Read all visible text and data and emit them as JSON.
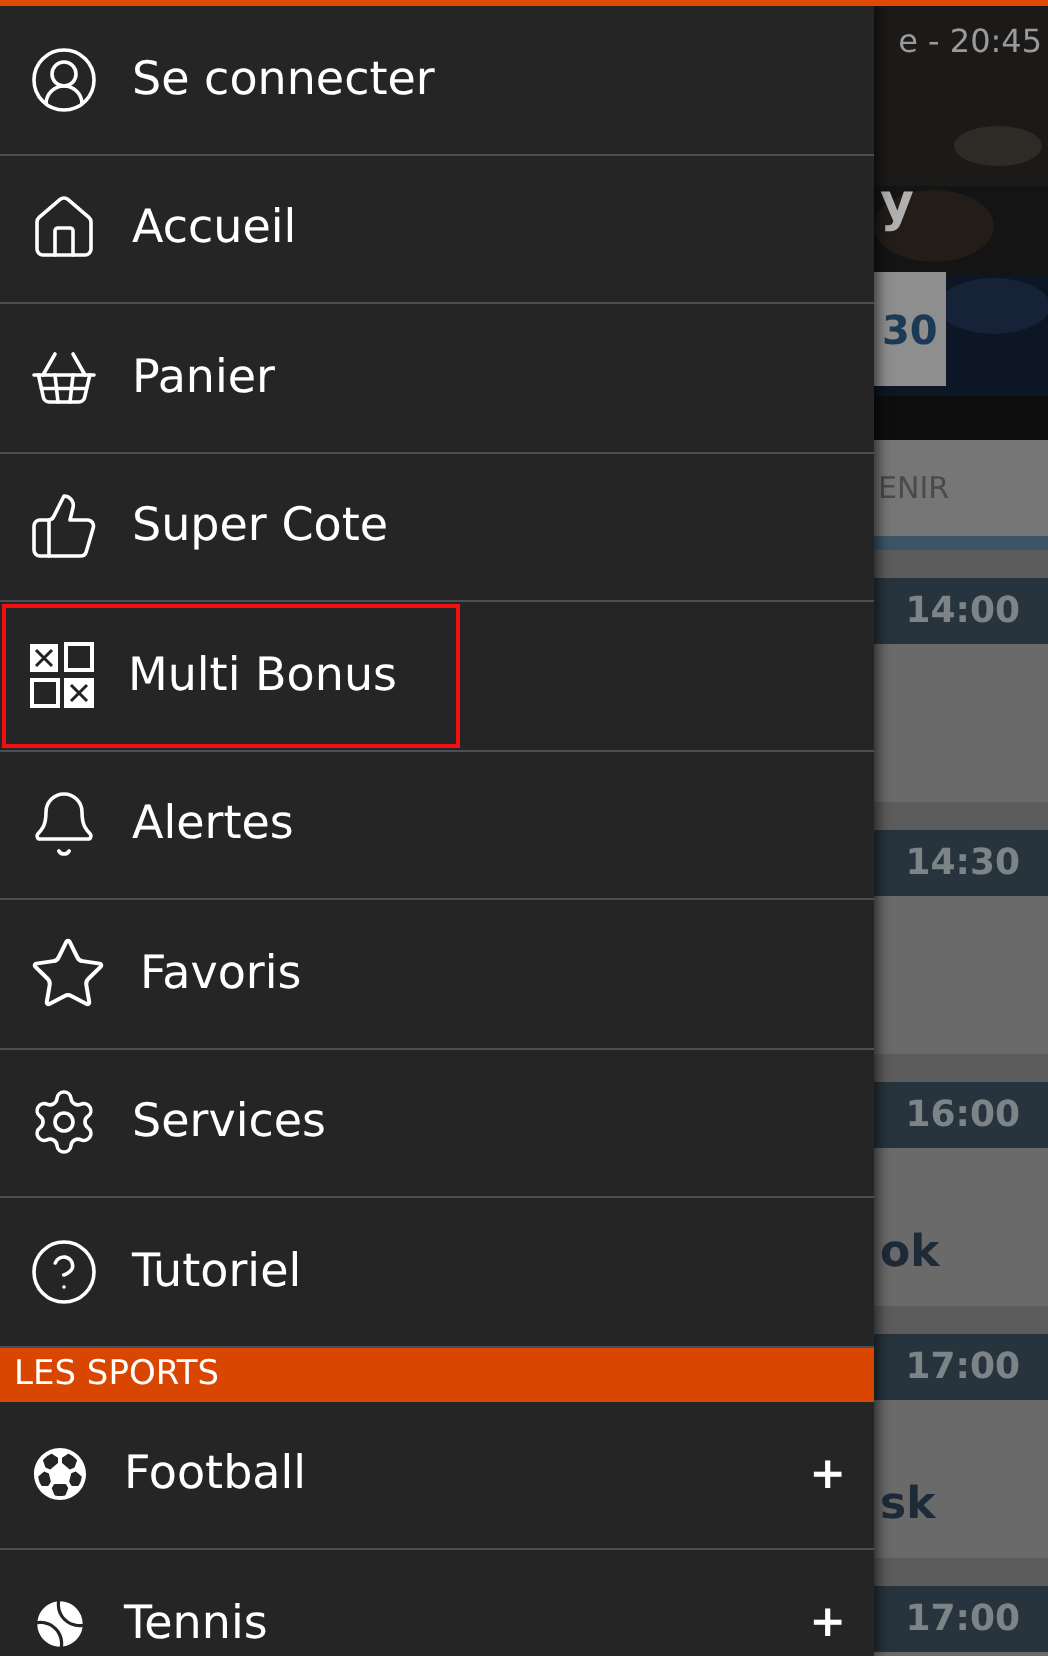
{
  "menu": {
    "items": [
      {
        "label": "Se connecter",
        "highlighted": false
      },
      {
        "label": "Accueil",
        "highlighted": false
      },
      {
        "label": "Panier",
        "highlighted": false
      },
      {
        "label": "Super Cote",
        "highlighted": false
      },
      {
        "label": "Multi Bonus",
        "highlighted": true
      },
      {
        "label": "Alertes",
        "highlighted": false
      },
      {
        "label": "Favoris",
        "highlighted": false
      },
      {
        "label": "Services",
        "highlighted": false
      },
      {
        "label": "Tutoriel",
        "highlighted": false
      }
    ]
  },
  "sports": {
    "title": "LES SPORTS",
    "items": [
      {
        "label": "Football",
        "toggle": "+"
      },
      {
        "label": "Tennis",
        "toggle": "+"
      }
    ]
  },
  "background": {
    "status_time": "e - 20:45",
    "banner": {
      "title": "y",
      "odds": "30"
    },
    "tab": "ENIR",
    "events": [
      {
        "time": "14:00"
      },
      {
        "time": "14:30"
      },
      {
        "time": "16:00",
        "name": "ok"
      },
      {
        "time": "17:00",
        "name": "sk"
      },
      {
        "time": "17:00"
      }
    ]
  }
}
